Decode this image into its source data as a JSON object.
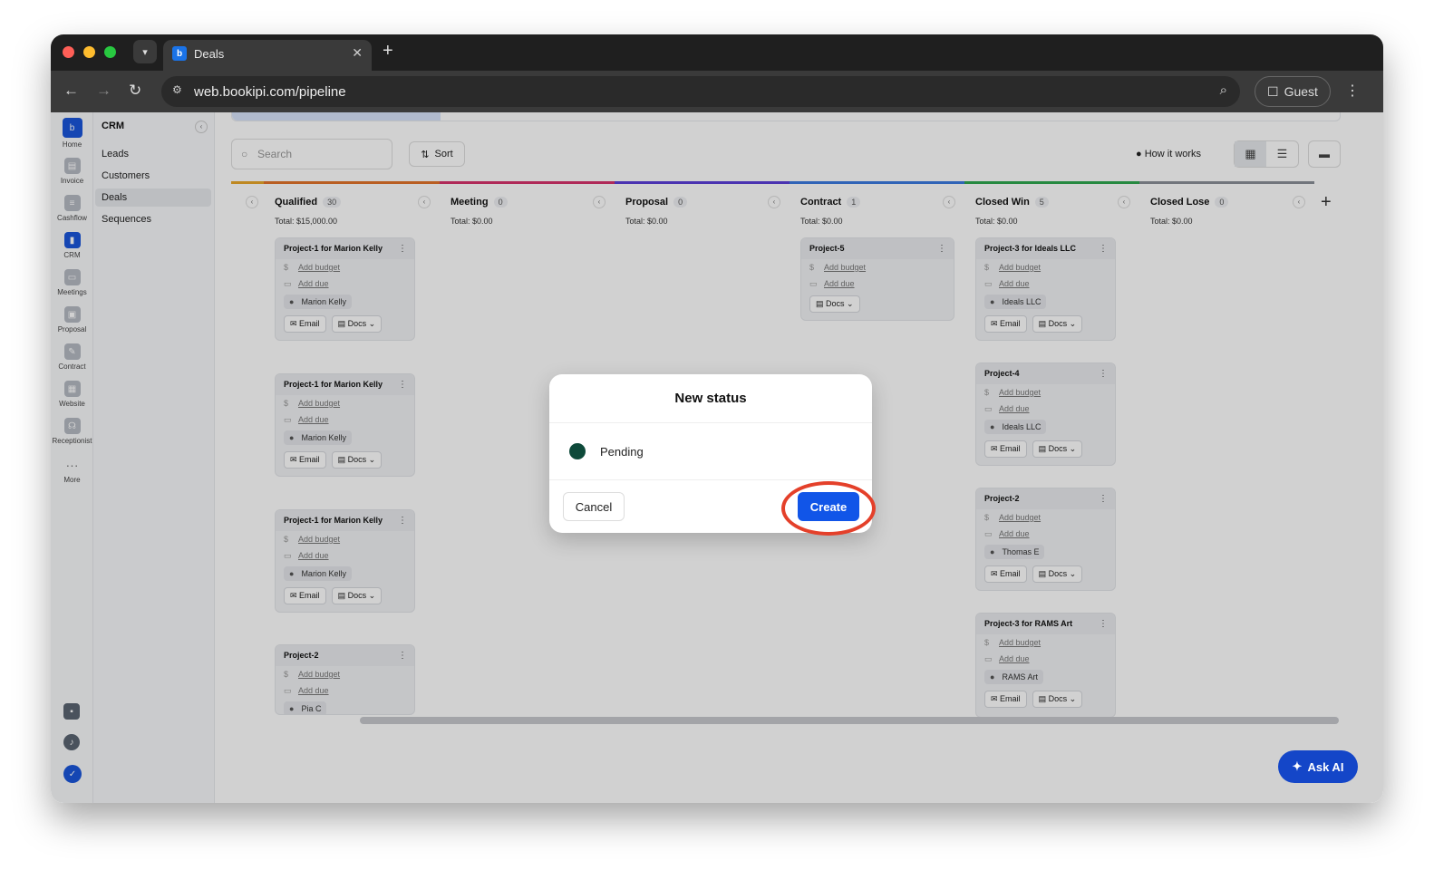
{
  "browser": {
    "tab_title": "Deals",
    "url": "web.bookipi.com/pipeline",
    "profile": "Guest"
  },
  "rail": [
    {
      "label": "Home",
      "icon": "home-icon"
    },
    {
      "label": "Invoice",
      "icon": "invoice-icon"
    },
    {
      "label": "Cashflow",
      "icon": "cashflow-icon"
    },
    {
      "label": "CRM",
      "icon": "crm-icon"
    },
    {
      "label": "Meetings",
      "icon": "meetings-icon"
    },
    {
      "label": "Proposal",
      "icon": "proposal-icon"
    },
    {
      "label": "Contract",
      "icon": "contract-icon"
    },
    {
      "label": "Website",
      "icon": "website-icon"
    },
    {
      "label": "Receptionist",
      "icon": "receptionist-icon"
    },
    {
      "label": "More",
      "icon": "more-icon"
    }
  ],
  "subnav": {
    "header": "CRM",
    "items": [
      "Leads",
      "Customers",
      "Deals",
      "Sequences"
    ],
    "selected": "Deals"
  },
  "toolbar": {
    "search_placeholder": "Search",
    "sort_label": "Sort",
    "how_label": "How it works"
  },
  "columns": [
    {
      "title": "Qualified",
      "count": "30",
      "total": "Total: $15,000.00",
      "color": "#e2732a"
    },
    {
      "title": "Meeting",
      "count": "0",
      "total": "Total: $0.00",
      "color": "#d6336c"
    },
    {
      "title": "Proposal",
      "count": "0",
      "total": "Total: $0.00",
      "color": "#5b3fd8"
    },
    {
      "title": "Contract",
      "count": "1",
      "total": "Total: $0.00",
      "color": "#3b7be0"
    },
    {
      "title": "Closed Win",
      "count": "5",
      "total": "Total: $0.00",
      "color": "#2fa84f"
    },
    {
      "title": "Closed Lose",
      "count": "0",
      "total": "Total: $0.00",
      "color": "#8a8f98"
    }
  ],
  "cards": {
    "qualified": [
      {
        "title": "Project-1 for Marion Kelly",
        "budget": "Add budget",
        "due": "Add due",
        "person": "Marion Kelly",
        "email": "Email",
        "docs": "Docs"
      },
      {
        "title": "Project-1 for Marion Kelly",
        "budget": "Add budget",
        "due": "Add due",
        "person": "Marion Kelly",
        "email": "Email",
        "docs": "Docs"
      },
      {
        "title": "Project-1 for Marion Kelly",
        "budget": "Add budget",
        "due": "Add due",
        "person": "Marion Kelly",
        "email": "Email",
        "docs": "Docs"
      },
      {
        "title": "Project-2",
        "budget": "Add budget",
        "due": "Add due",
        "person": "Pia C"
      }
    ],
    "contract": [
      {
        "title": "Project-5",
        "budget": "Add budget",
        "due": "Add due",
        "docs": "Docs"
      }
    ],
    "closed_win": [
      {
        "title": "Project-3 for Ideals LLC",
        "budget": "Add budget",
        "due": "Add due",
        "person": "Ideals LLC",
        "email": "Email",
        "docs": "Docs"
      },
      {
        "title": "Project-4",
        "budget": "Add budget",
        "due": "Add due",
        "person": "Ideals LLC",
        "email": "Email",
        "docs": "Docs"
      },
      {
        "title": "Project-2",
        "budget": "Add budget",
        "due": "Add due",
        "person": "Thomas E",
        "email": "Email",
        "docs": "Docs"
      },
      {
        "title": "Project-3 for RAMS Art",
        "budget": "Add budget",
        "due": "Add due",
        "person": "RAMS Art",
        "email": "Email",
        "docs": "Docs"
      }
    ]
  },
  "modal": {
    "title": "New status",
    "status_name": "Pending",
    "status_color": "#0e4a3a",
    "cancel_label": "Cancel",
    "create_label": "Create"
  },
  "ask_ai_label": "Ask AI",
  "colors": {
    "accent": "#1155e8",
    "highlight_ring": "#e4402a"
  }
}
